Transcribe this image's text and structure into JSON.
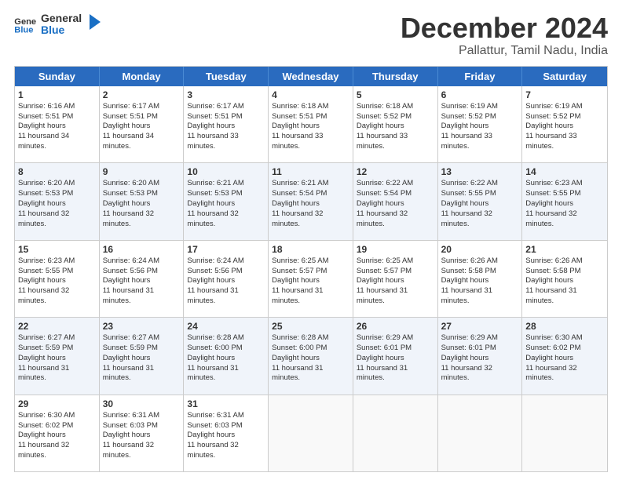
{
  "logo": {
    "text_general": "General",
    "text_blue": "Blue"
  },
  "title": {
    "month": "December 2024",
    "location": "Pallattur, Tamil Nadu, India"
  },
  "calendar": {
    "headers": [
      "Sunday",
      "Monday",
      "Tuesday",
      "Wednesday",
      "Thursday",
      "Friday",
      "Saturday"
    ],
    "weeks": [
      [
        {
          "day": "",
          "empty": true
        },
        {
          "day": "",
          "empty": true
        },
        {
          "day": "",
          "empty": true
        },
        {
          "day": "",
          "empty": true
        },
        {
          "day": "",
          "empty": true
        },
        {
          "day": "",
          "empty": true
        },
        {
          "day": "",
          "empty": true
        }
      ],
      [
        {
          "day": "1",
          "rise": "6:16 AM",
          "set": "5:51 PM",
          "daylight": "11 hours and 34 minutes."
        },
        {
          "day": "2",
          "rise": "6:17 AM",
          "set": "5:51 PM",
          "daylight": "11 hours and 34 minutes."
        },
        {
          "day": "3",
          "rise": "6:17 AM",
          "set": "5:51 PM",
          "daylight": "11 hours and 33 minutes."
        },
        {
          "day": "4",
          "rise": "6:18 AM",
          "set": "5:51 PM",
          "daylight": "11 hours and 33 minutes."
        },
        {
          "day": "5",
          "rise": "6:18 AM",
          "set": "5:52 PM",
          "daylight": "11 hours and 33 minutes."
        },
        {
          "day": "6",
          "rise": "6:19 AM",
          "set": "5:52 PM",
          "daylight": "11 hours and 33 minutes."
        },
        {
          "day": "7",
          "rise": "6:19 AM",
          "set": "5:52 PM",
          "daylight": "11 hours and 33 minutes."
        }
      ],
      [
        {
          "day": "8",
          "rise": "6:20 AM",
          "set": "5:53 PM",
          "daylight": "11 hours and 32 minutes."
        },
        {
          "day": "9",
          "rise": "6:20 AM",
          "set": "5:53 PM",
          "daylight": "11 hours and 32 minutes."
        },
        {
          "day": "10",
          "rise": "6:21 AM",
          "set": "5:53 PM",
          "daylight": "11 hours and 32 minutes."
        },
        {
          "day": "11",
          "rise": "6:21 AM",
          "set": "5:54 PM",
          "daylight": "11 hours and 32 minutes."
        },
        {
          "day": "12",
          "rise": "6:22 AM",
          "set": "5:54 PM",
          "daylight": "11 hours and 32 minutes."
        },
        {
          "day": "13",
          "rise": "6:22 AM",
          "set": "5:55 PM",
          "daylight": "11 hours and 32 minutes."
        },
        {
          "day": "14",
          "rise": "6:23 AM",
          "set": "5:55 PM",
          "daylight": "11 hours and 32 minutes."
        }
      ],
      [
        {
          "day": "15",
          "rise": "6:23 AM",
          "set": "5:55 PM",
          "daylight": "11 hours and 32 minutes."
        },
        {
          "day": "16",
          "rise": "6:24 AM",
          "set": "5:56 PM",
          "daylight": "11 hours and 31 minutes."
        },
        {
          "day": "17",
          "rise": "6:24 AM",
          "set": "5:56 PM",
          "daylight": "11 hours and 31 minutes."
        },
        {
          "day": "18",
          "rise": "6:25 AM",
          "set": "5:57 PM",
          "daylight": "11 hours and 31 minutes."
        },
        {
          "day": "19",
          "rise": "6:25 AM",
          "set": "5:57 PM",
          "daylight": "11 hours and 31 minutes."
        },
        {
          "day": "20",
          "rise": "6:26 AM",
          "set": "5:58 PM",
          "daylight": "11 hours and 31 minutes."
        },
        {
          "day": "21",
          "rise": "6:26 AM",
          "set": "5:58 PM",
          "daylight": "11 hours and 31 minutes."
        }
      ],
      [
        {
          "day": "22",
          "rise": "6:27 AM",
          "set": "5:59 PM",
          "daylight": "11 hours and 31 minutes."
        },
        {
          "day": "23",
          "rise": "6:27 AM",
          "set": "5:59 PM",
          "daylight": "11 hours and 31 minutes."
        },
        {
          "day": "24",
          "rise": "6:28 AM",
          "set": "6:00 PM",
          "daylight": "11 hours and 31 minutes."
        },
        {
          "day": "25",
          "rise": "6:28 AM",
          "set": "6:00 PM",
          "daylight": "11 hours and 31 minutes."
        },
        {
          "day": "26",
          "rise": "6:29 AM",
          "set": "6:01 PM",
          "daylight": "11 hours and 31 minutes."
        },
        {
          "day": "27",
          "rise": "6:29 AM",
          "set": "6:01 PM",
          "daylight": "11 hours and 32 minutes."
        },
        {
          "day": "28",
          "rise": "6:30 AM",
          "set": "6:02 PM",
          "daylight": "11 hours and 32 minutes."
        }
      ],
      [
        {
          "day": "29",
          "rise": "6:30 AM",
          "set": "6:02 PM",
          "daylight": "11 hours and 32 minutes."
        },
        {
          "day": "30",
          "rise": "6:31 AM",
          "set": "6:03 PM",
          "daylight": "11 hours and 32 minutes."
        },
        {
          "day": "31",
          "rise": "6:31 AM",
          "set": "6:03 PM",
          "daylight": "11 hours and 32 minutes."
        },
        {
          "day": "",
          "empty": true
        },
        {
          "day": "",
          "empty": true
        },
        {
          "day": "",
          "empty": true
        },
        {
          "day": "",
          "empty": true
        }
      ]
    ]
  }
}
